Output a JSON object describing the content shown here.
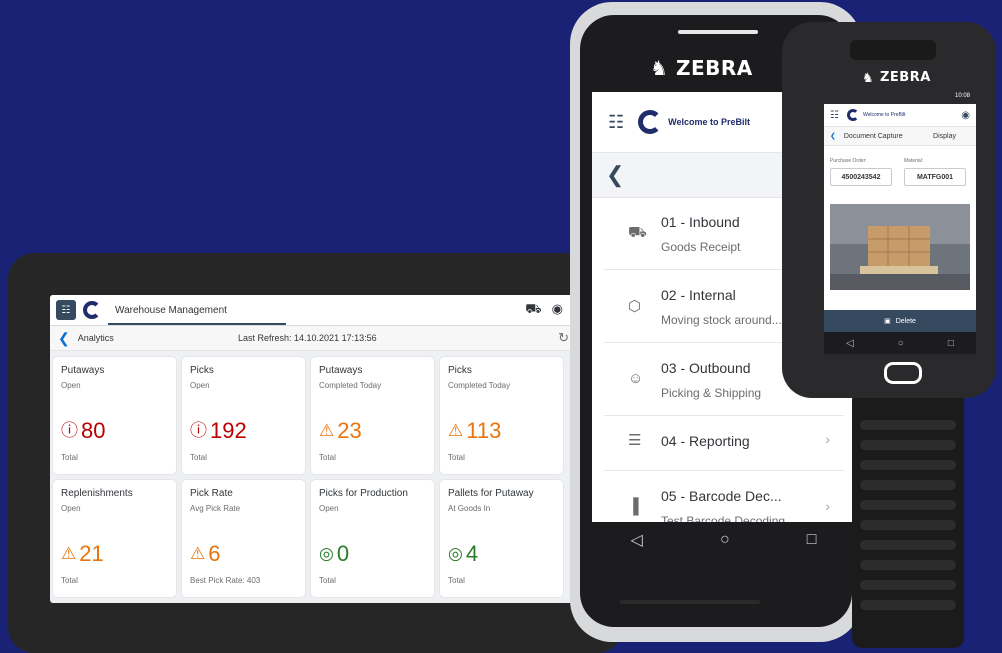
{
  "tablet": {
    "header_title": "Warehouse Management",
    "sub_back_label": "Analytics",
    "last_refresh": "Last Refresh: 14.10.2021 17:13:56",
    "tiles": [
      {
        "title": "Putaways",
        "subtitle": "Open",
        "value": "80",
        "footer": "Total",
        "status": "error",
        "color": "#bb0000"
      },
      {
        "title": "Picks",
        "subtitle": "Open",
        "value": "192",
        "footer": "Total",
        "status": "error",
        "color": "#bb0000"
      },
      {
        "title": "Putaways",
        "subtitle": "Completed Today",
        "value": "23",
        "footer": "Total",
        "status": "warning",
        "color": "#e9730c"
      },
      {
        "title": "Picks",
        "subtitle": "Completed Today",
        "value": "113",
        "footer": "Total",
        "status": "warning",
        "color": "#e9730c"
      },
      {
        "title": "Replenishments",
        "subtitle": "Open",
        "value": "21",
        "footer": "Total",
        "status": "warning",
        "color": "#e9730c"
      },
      {
        "title": "Pick Rate",
        "subtitle": "Avg Pick Rate",
        "value": "6",
        "footer": "Best Pick Rate: 403",
        "status": "warning",
        "color": "#e9730c"
      },
      {
        "title": "Picks for Production",
        "subtitle": "Open",
        "value": "0",
        "footer": "Total",
        "status": "success",
        "color": "#2b7d2b"
      },
      {
        "title": "Pallets for Putaway",
        "subtitle": "At Goods In",
        "value": "4",
        "footer": "Total",
        "status": "success",
        "color": "#2b7d2b"
      }
    ]
  },
  "mid_device": {
    "brand": "ZEBRA",
    "header_title": "Welcome to PreBilt",
    "items": [
      {
        "title": "01 - Inbound",
        "subtitle": "Goods Receipt",
        "icon": "truck-icon"
      },
      {
        "title": "02 - Internal",
        "subtitle": "Moving stock around...",
        "icon": "box-icon"
      },
      {
        "title": "03 - Outbound",
        "subtitle": "Picking & Shipping",
        "icon": "person-box-icon"
      },
      {
        "title": "04 - Reporting",
        "subtitle": "",
        "icon": "report-icon"
      },
      {
        "title": "05 - Barcode Dec...",
        "subtitle": "Test Barcode Decoding",
        "icon": "barcode-icon"
      }
    ]
  },
  "scanner": {
    "brand": "ZEBRA",
    "time": "10:08",
    "header_title": "Welcome to PreBilt",
    "page_title": "Document Capture",
    "display_label": "Display",
    "po_label": "Purchase Order:",
    "po_value": "4500243542",
    "material_label": "Material:",
    "material_value": "MATFG001",
    "delete_label": "Delete"
  }
}
